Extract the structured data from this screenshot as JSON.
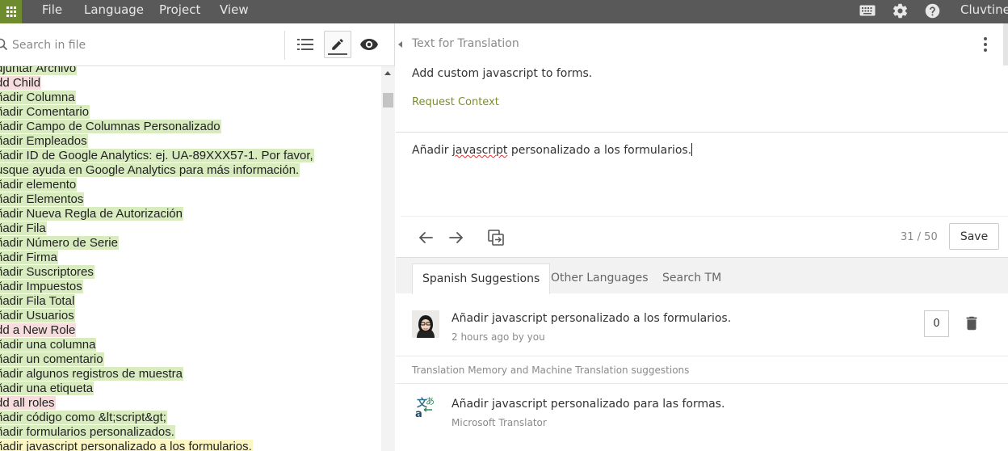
{
  "menu": {
    "file": "File",
    "language": "Language",
    "project": "Project",
    "view": "View",
    "user": "Cluvtine"
  },
  "top_icons": [
    "keyboard-icon",
    "gear-icon",
    "help-icon"
  ],
  "sidebar": {
    "search_placeholder": "Search in file",
    "tools": [
      "list-icon",
      "pencil-icon",
      "eye-icon"
    ],
    "strings": [
      {
        "text": "djuntar Archivo",
        "status": "green"
      },
      {
        "text": "dd Child",
        "status": "pink"
      },
      {
        "text": "ñadir Columna",
        "status": "green"
      },
      {
        "text": "ñadir Comentario",
        "status": "green"
      },
      {
        "text": "ñadir Campo de Columnas Personalizado",
        "status": "green"
      },
      {
        "text": "ñadir Empleados",
        "status": "green"
      },
      {
        "text": "ñadir ID de Google Analytics: ej. UA-89XXX57-1. Por favor,",
        "status": "green"
      },
      {
        "text": "usque ayuda en Google Analytics para más información.",
        "status": "green"
      },
      {
        "text": "ñadir elemento",
        "status": "green"
      },
      {
        "text": "ñadir Elementos",
        "status": "green"
      },
      {
        "text": "ñadir Nueva Regla de Autorización",
        "status": "green"
      },
      {
        "text": "ñadir Fila",
        "status": "green"
      },
      {
        "text": "ñadir Número de Serie",
        "status": "green"
      },
      {
        "text": "ñadir Firma",
        "status": "green"
      },
      {
        "text": "ñadir Suscriptores",
        "status": "green"
      },
      {
        "text": "ñadir Impuestos",
        "status": "green"
      },
      {
        "text": "ñadir Fila Total",
        "status": "green"
      },
      {
        "text": "ñadir Usuarios",
        "status": "green"
      },
      {
        "text": "dd a New Role",
        "status": "pink"
      },
      {
        "text": "ñadir una columna",
        "status": "green"
      },
      {
        "text": "ñadir un comentario",
        "status": "green"
      },
      {
        "text": "ñadir algunos registros de muestra",
        "status": "green"
      },
      {
        "text": "ñadir una etiqueta",
        "status": "green"
      },
      {
        "text": "dd all roles",
        "status": "pink"
      },
      {
        "text": "ñadir código como &lt;script&gt;",
        "status": "green"
      },
      {
        "text": "ñadir formularios personalizados.",
        "status": "green"
      },
      {
        "text": "ñadir javascript personalizado a los formularios.",
        "status": "yellow"
      }
    ]
  },
  "editor": {
    "source_label": "Text for Translation",
    "source_text": "Add custom javascript to forms.",
    "request_context": "Request Context",
    "translation_before": "Añadir ",
    "translation_misspelled": "javascript",
    "translation_after": " personalizado a los formularios.",
    "counter": "31 / 50",
    "save_label": "Save"
  },
  "tabs": [
    "Spanish Suggestions",
    "Other Languages",
    "Search TM"
  ],
  "suggestion": {
    "text": "Añadir javascript personalizado a los formularios.",
    "meta": "2 hours ago by you",
    "votes": "0"
  },
  "tm_header": "Translation Memory and Machine Translation suggestions",
  "mt_suggestion": {
    "text": "Añadir javascript personalizado para las formas.",
    "source": "Microsoft Translator"
  },
  "colors": {
    "accent_green": "#6e8c2d",
    "topbar": "#595959",
    "approved_highlight": "#d9ecc0",
    "untranslated_highlight": "#f6dcdc",
    "selected_highlight": "#fbf6c4"
  }
}
